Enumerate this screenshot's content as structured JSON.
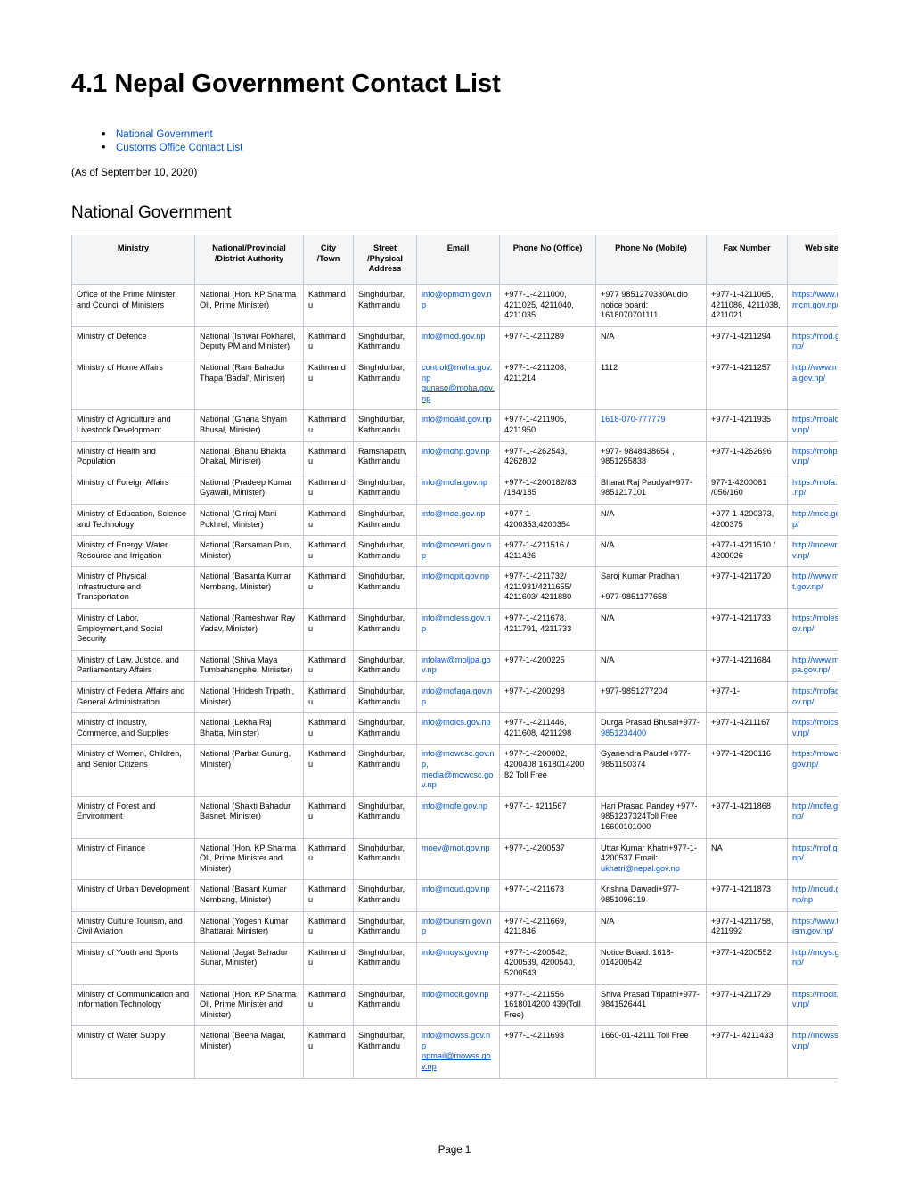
{
  "document": {
    "title": "4.1 Nepal Government Contact List",
    "toc": [
      {
        "label": "National Government"
      },
      {
        "label": "Customs Office Contact List"
      }
    ],
    "as_of": "(As of September 10, 2020)",
    "section_title": "National Government",
    "footer": "Page 1"
  },
  "table": {
    "headers": [
      "Ministry",
      "National/Provincial /District Authority",
      "City /Town",
      "Street /Physical Address",
      "Email",
      "Phone No (Office)",
      "Phone No (Mobile)",
      "Fax Number",
      "Web site"
    ],
    "rows": [
      {
        "ministry": "Office of the Prime Minister and Council of Ministers",
        "authority": "National  (Hon. KP Sharma Oli, Prime Minister)",
        "city": "Kathmandu",
        "street": "Singhdurbar, Kathmandu",
        "email": "info@opmcm.gov.np",
        "email2": "",
        "office": "+977-1-4211000, 4211025, 4211040, 4211035",
        "mobile": "+977 9851270330Audio notice board: 1618070701111",
        "mobile_link": "",
        "mobile2": "",
        "fax": "+977-1-4211065, 4211086, 4211038, 4211021",
        "web": "https://www.opmcm.gov.np/"
      },
      {
        "ministry": "Ministry of Defence",
        "authority": "National  (Ishwar Pokharel, Deputy PM and Minister)",
        "city": "Kathmandu",
        "street": "Singhdurbar, Kathmandu",
        "email": "info@mod.gov.np",
        "email2": "",
        "office": "+977-1-4211289",
        "mobile": "N/A",
        "mobile_link": "",
        "mobile2": "",
        "fax": "+977-1-4211294",
        "web": "https://mod.gov.np/"
      },
      {
        "ministry": "Ministry of Home Affairs",
        "authority": "National  (Ram Bahadur Thapa 'Badal', Minister)",
        "city": "Kathmandu",
        "street": "Singhdurbar, Kathmandu",
        "email": "control@moha.gov.np",
        "email2": "gunaso@moha.gov.np",
        "office": "+977-1-4211208, 4211214",
        "mobile": "1112",
        "mobile_link": "",
        "mobile2": "",
        "fax": "+977-1-4211257",
        "web": "http://www.moha.gov.np/"
      },
      {
        "ministry": "Ministry of Agriculture and Livestock Development",
        "authority": "National  (Ghana Shyam Bhusal, Minister)",
        "city": "Kathmandu",
        "street": "Singhdurbar, Kathmandu",
        "email": "info@moald.gov.np",
        "email2": "",
        "office": "+977-1-4211905, 4211950",
        "mobile": "",
        "mobile_link": "1618-070-777779",
        "mobile2": "",
        "fax": "+977-1-4211935",
        "web": "https://moald.gov.np/"
      },
      {
        "ministry": "Ministry of Health and Population",
        "authority": "National  (Bhanu Bhakta Dhakal, Minister)",
        "city": "Kathmandu",
        "street": "Ramshapath, Kathmandu",
        "email": "info@mohp.gov.np",
        "email2": "",
        "office": "+977-1-4262543, 4262802",
        "mobile": "+977- 9848438654 , 9851255838",
        "mobile_link": "",
        "mobile2": "",
        "fax": "+977-1-4262696",
        "web": "https://mohp.gov.np/"
      },
      {
        "ministry": "Ministry of Foreign Affairs",
        "authority": "National  (Pradeep Kumar  Gyawali, Minister)",
        "city": "Kathmandu",
        "street": "Singhdurbar, Kathmandu",
        "email": "info@mofa.gov.np",
        "email2": "",
        "office": "+977-1-4200182/83 /184/185",
        "mobile": "Bharat Raj Paudyal+977-9851217101",
        "mobile_link": "",
        "mobile2": "",
        "fax": "977-1-4200061 /056/160",
        "web": "https://mofa.gov.np/"
      },
      {
        "ministry": "Ministry of Education, Science and Technology",
        "authority": "National  (Giriraj Mani Pokhrel, Minister)",
        "city": "Kathmandu",
        "street": "Singhdurbar, Kathmandu",
        "email": "info@moe.gov.np",
        "email2": "",
        "office": "+977-1-4200353,4200354",
        "mobile": "N/A",
        "mobile_link": "",
        "mobile2": "",
        "fax": "+977-1-4200373, 4200375",
        "web": "http://moe.gov.np/"
      },
      {
        "ministry": "Ministry of Energy, Water Resource and Irrigation",
        "authority": "National (Barsaman Pun, Minister)",
        "city": "Kathmandu",
        "street": "Singhdurbar, Kathmandu",
        "email": "info@moewri.gov.np",
        "email2": "",
        "office": "+977-1-4211516 / 4211426",
        "mobile": "N/A",
        "mobile_link": "",
        "mobile2": "",
        "fax": "+977-1-4211510 / 4200026",
        "web": "http://moewri.gov.np/"
      },
      {
        "ministry": "Ministry of Physical Infrastructure and Transportation",
        "authority": "National (Basanta Kumar Nembang, Minister)",
        "city": "Kathmandu",
        "street": "Singhdurbar, Kathmandu",
        "email": "info@mopit.gov.np",
        "email2": "",
        "office": "+977-1-4211732/ 4211931/4211655/ 4211603/ 4211880",
        "mobile": "Saroj Kumar Pradhan",
        "mobile_link": "",
        "mobile2": "+977-9851177658",
        "fax": "+977-1-4211720",
        "web": "http://www.mopit.gov.np/"
      },
      {
        "ministry": "Ministry of Labor, Employment,and Social Security",
        "authority": "National (Rameshwar Ray Yadav, Minister)",
        "city": "Kathmandu",
        "street": "Singhdurbar, Kathmandu",
        "email": "info@moless.gov.np",
        "email2": "",
        "office": "+977-1-4211678, 4211791, 4211733",
        "mobile": "N/A",
        "mobile_link": "",
        "mobile2": "",
        "fax": "+977-1-4211733",
        "web": "https://moless.gov.np/"
      },
      {
        "ministry": "Ministry of Law, Justice, and Parliamentary Affairs",
        "authority": "National  (Shiva Maya Tumbahangphe, Minister)",
        "city": "Kathmandu",
        "street": "Singhdurbar, Kathmandu",
        "email": "infolaw@moljpa.gov.np",
        "email2": "",
        "office": "+977-1-4200225",
        "mobile": "N/A",
        "mobile_link": "",
        "mobile2": "",
        "fax": "+977-1-4211684",
        "web": "http://www.moljpa.gov.np/"
      },
      {
        "ministry": "Ministry of Federal Affairs and General Administration",
        "authority": "National  (Hridesh Tripathi, Minister)",
        "city": "Kathmandu",
        "street": "Singhdurbar, Kathmandu",
        "email": "info@mofaga.gov.np",
        "email2": "",
        "office": "+977-1-4200298",
        "mobile": "+977-9851277204",
        "mobile_link": "",
        "mobile2": "",
        "fax": "+977-1-",
        "web": "https://mofaga.gov.np/"
      },
      {
        "ministry": "Ministry of Industry, Commerce, and Supplies",
        "authority": "National  (Lekha Raj Bhatta, Minister)",
        "city": "Kathmandu",
        "street": "Singhdurbar, Kathmandu",
        "email": "info@moics.gov.np",
        "email2": "",
        "office": "+977-1-4211446, 4211608, 4211298",
        "mobile": "Durga Prasad Bhusal+977-",
        "mobile_link": "9851234400",
        "mobile2": "",
        "fax": "+977-1-4211167",
        "web": "https://moics.gov.np/"
      },
      {
        "ministry": "Ministry of Women, Children, and Senior Citizens",
        "authority": "National  (Parbat Gurung, Minister)",
        "city": "Kathmandu",
        "street": "Singhdurbar, Kathmandu",
        "email": "info@mowcsc.gov.np,  media@mowcsc.gov.np",
        "email2": "",
        "office": "+977-1-4200082, 4200408 1618014200 82 Toll Free",
        "mobile": "Gyanendra Paudel+977-9851150374",
        "mobile_link": "",
        "mobile2": "",
        "fax": "+977-1-4200116",
        "web": "https://mowcsc.gov.np/"
      },
      {
        "ministry": "Ministry of Forest and Environment",
        "authority": "National  (Shakti Bahadur Basnet, Minister)",
        "city": "Kathmandu",
        "street": "Singhdurbar, Kathmandu",
        "email": "info@mofe.gov.np",
        "email2": "",
        "office": "+977-1- 4211567",
        "mobile": "Hari Prasad Pandey +977-9851237324Toll Free 16600101000",
        "mobile_link": "",
        "mobile2": "",
        "fax": "+977-1-4211868",
        "web": "http://mofe.gov.np/"
      },
      {
        "ministry": "Ministry of Finance",
        "authority": "National  (Hon. KP Sharma Oli, Prime Minister and Minister)",
        "city": "Kathmandu",
        "street": "Singhdurbar, Kathmandu",
        "email": "moev@mof.gov.np",
        "email2": "",
        "office": "+977-1-4200537",
        "mobile": "Uttar Kumar Khatri+977-1-4200537 Email: ",
        "mobile_link": "ukhatri@nepal.gov.np",
        "mobile2": "",
        "fax": "NA",
        "web": "https://mof.gov.np/"
      },
      {
        "ministry": "Ministry of Urban Development",
        "authority": "National  (Basant Kumar Nembang, Minister)",
        "city": "Kathmandu",
        "street": "Singhdurbar, Kathmandu",
        "email": "info@moud.gov.np",
        "email2": "",
        "office": "+977-1-4211673",
        "mobile": "Krishna Dawadi+977-9851096119",
        "mobile_link": "",
        "mobile2": "",
        "fax": "+977-1-4211873",
        "web": "http://moud.gov.np/np"
      },
      {
        "ministry": "Ministry Culture Tourism, and Civil Aviation",
        "authority": "National  (Yogesh Kumar Bhattarai, Minister)",
        "city": "Kathmandu",
        "street": "Singhdurbar, Kathmandu",
        "email": "info@tourism.gov.np",
        "email2": "",
        "office": "+977-1-4211669, 4211846",
        "mobile": " N/A",
        "mobile_link": "",
        "mobile2": "",
        "fax": "+977-1-4211758, 4211992",
        "web": "https://www.tourism.gov.np/"
      },
      {
        "ministry": "Ministry of Youth and Sports",
        "authority": "National (Jagat Bahadur Sunar, Minister)",
        "city": "Kathmandu",
        "street": "Singhdurbar, Kathmandu",
        "email": "info@moys.gov.np",
        "email2": "",
        "office": "+977-1-4200542, 4200539, 4200540, 5200543",
        "mobile": "Notice Board:  1618-014200542",
        "mobile_link": "",
        "mobile2": "",
        "fax": "+977-1-4200552",
        "web": "http://moys.gov.np/"
      },
      {
        "ministry": "Ministry of Communication and Information Technology",
        "authority": "National (Hon. KP Sharma Oli, Prime Minister and Minister)",
        "city": "Kathmandu",
        "street": "Singhdurbar, Kathmandu",
        "email": "info@mocit.gov.np",
        "email2": "",
        "office": "+977-1-4211556 1618014200 439(Toll Free)",
        "mobile": "Shiva Prasad Tripathi+977-9841526441",
        "mobile_link": "",
        "mobile2": "",
        "fax": "+977-1-4211729",
        "web": "https://mocit.gov.np/"
      },
      {
        "ministry": "Ministry of Water Supply",
        "authority": "National  (Beena Magar, Minister)",
        "city": "Kathmandu",
        "street": "Singhdurbar, Kathmandu",
        "email": "info@mowss.gov.np",
        "email2": "npmail@mowss.gov.np",
        "office": "+977-1-4211693",
        "mobile": "1660-01-42111 Toll Free",
        "mobile_link": "",
        "mobile2": "",
        "fax": "+977-1- 4211433",
        "web": "http://mowss.gov.np/"
      }
    ]
  }
}
